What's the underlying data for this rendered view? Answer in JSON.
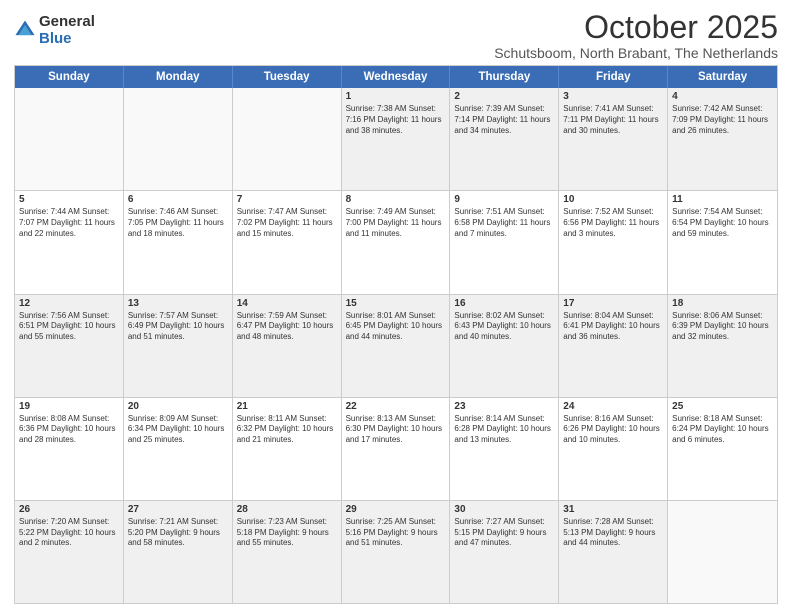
{
  "logo": {
    "general": "General",
    "blue": "Blue"
  },
  "header": {
    "title": "October 2025",
    "subtitle": "Schutsboom, North Brabant, The Netherlands"
  },
  "weekdays": [
    "Sunday",
    "Monday",
    "Tuesday",
    "Wednesday",
    "Thursday",
    "Friday",
    "Saturday"
  ],
  "rows": [
    [
      {
        "day": "",
        "text": ""
      },
      {
        "day": "",
        "text": ""
      },
      {
        "day": "",
        "text": ""
      },
      {
        "day": "1",
        "text": "Sunrise: 7:38 AM\nSunset: 7:16 PM\nDaylight: 11 hours\nand 38 minutes."
      },
      {
        "day": "2",
        "text": "Sunrise: 7:39 AM\nSunset: 7:14 PM\nDaylight: 11 hours\nand 34 minutes."
      },
      {
        "day": "3",
        "text": "Sunrise: 7:41 AM\nSunset: 7:11 PM\nDaylight: 11 hours\nand 30 minutes."
      },
      {
        "day": "4",
        "text": "Sunrise: 7:42 AM\nSunset: 7:09 PM\nDaylight: 11 hours\nand 26 minutes."
      }
    ],
    [
      {
        "day": "5",
        "text": "Sunrise: 7:44 AM\nSunset: 7:07 PM\nDaylight: 11 hours\nand 22 minutes."
      },
      {
        "day": "6",
        "text": "Sunrise: 7:46 AM\nSunset: 7:05 PM\nDaylight: 11 hours\nand 18 minutes."
      },
      {
        "day": "7",
        "text": "Sunrise: 7:47 AM\nSunset: 7:02 PM\nDaylight: 11 hours\nand 15 minutes."
      },
      {
        "day": "8",
        "text": "Sunrise: 7:49 AM\nSunset: 7:00 PM\nDaylight: 11 hours\nand 11 minutes."
      },
      {
        "day": "9",
        "text": "Sunrise: 7:51 AM\nSunset: 6:58 PM\nDaylight: 11 hours\nand 7 minutes."
      },
      {
        "day": "10",
        "text": "Sunrise: 7:52 AM\nSunset: 6:56 PM\nDaylight: 11 hours\nand 3 minutes."
      },
      {
        "day": "11",
        "text": "Sunrise: 7:54 AM\nSunset: 6:54 PM\nDaylight: 10 hours\nand 59 minutes."
      }
    ],
    [
      {
        "day": "12",
        "text": "Sunrise: 7:56 AM\nSunset: 6:51 PM\nDaylight: 10 hours\nand 55 minutes."
      },
      {
        "day": "13",
        "text": "Sunrise: 7:57 AM\nSunset: 6:49 PM\nDaylight: 10 hours\nand 51 minutes."
      },
      {
        "day": "14",
        "text": "Sunrise: 7:59 AM\nSunset: 6:47 PM\nDaylight: 10 hours\nand 48 minutes."
      },
      {
        "day": "15",
        "text": "Sunrise: 8:01 AM\nSunset: 6:45 PM\nDaylight: 10 hours\nand 44 minutes."
      },
      {
        "day": "16",
        "text": "Sunrise: 8:02 AM\nSunset: 6:43 PM\nDaylight: 10 hours\nand 40 minutes."
      },
      {
        "day": "17",
        "text": "Sunrise: 8:04 AM\nSunset: 6:41 PM\nDaylight: 10 hours\nand 36 minutes."
      },
      {
        "day": "18",
        "text": "Sunrise: 8:06 AM\nSunset: 6:39 PM\nDaylight: 10 hours\nand 32 minutes."
      }
    ],
    [
      {
        "day": "19",
        "text": "Sunrise: 8:08 AM\nSunset: 6:36 PM\nDaylight: 10 hours\nand 28 minutes."
      },
      {
        "day": "20",
        "text": "Sunrise: 8:09 AM\nSunset: 6:34 PM\nDaylight: 10 hours\nand 25 minutes."
      },
      {
        "day": "21",
        "text": "Sunrise: 8:11 AM\nSunset: 6:32 PM\nDaylight: 10 hours\nand 21 minutes."
      },
      {
        "day": "22",
        "text": "Sunrise: 8:13 AM\nSunset: 6:30 PM\nDaylight: 10 hours\nand 17 minutes."
      },
      {
        "day": "23",
        "text": "Sunrise: 8:14 AM\nSunset: 6:28 PM\nDaylight: 10 hours\nand 13 minutes."
      },
      {
        "day": "24",
        "text": "Sunrise: 8:16 AM\nSunset: 6:26 PM\nDaylight: 10 hours\nand 10 minutes."
      },
      {
        "day": "25",
        "text": "Sunrise: 8:18 AM\nSunset: 6:24 PM\nDaylight: 10 hours\nand 6 minutes."
      }
    ],
    [
      {
        "day": "26",
        "text": "Sunrise: 7:20 AM\nSunset: 5:22 PM\nDaylight: 10 hours\nand 2 minutes."
      },
      {
        "day": "27",
        "text": "Sunrise: 7:21 AM\nSunset: 5:20 PM\nDaylight: 9 hours\nand 58 minutes."
      },
      {
        "day": "28",
        "text": "Sunrise: 7:23 AM\nSunset: 5:18 PM\nDaylight: 9 hours\nand 55 minutes."
      },
      {
        "day": "29",
        "text": "Sunrise: 7:25 AM\nSunset: 5:16 PM\nDaylight: 9 hours\nand 51 minutes."
      },
      {
        "day": "30",
        "text": "Sunrise: 7:27 AM\nSunset: 5:15 PM\nDaylight: 9 hours\nand 47 minutes."
      },
      {
        "day": "31",
        "text": "Sunrise: 7:28 AM\nSunset: 5:13 PM\nDaylight: 9 hours\nand 44 minutes."
      },
      {
        "day": "",
        "text": ""
      }
    ]
  ]
}
